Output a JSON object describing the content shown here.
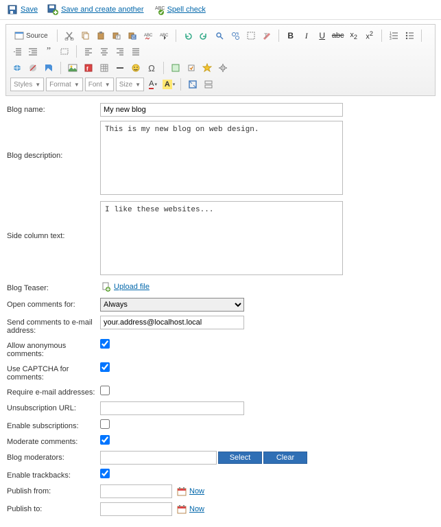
{
  "top": {
    "save": "Save",
    "save_another": "Save and create another",
    "spellcheck": "Spell check"
  },
  "toolbar": {
    "source": "Source",
    "styles": "Styles",
    "format": "Format",
    "font": "Font",
    "size": "Size"
  },
  "fields": {
    "blog_name": {
      "label": "Blog name:",
      "value": "My new blog"
    },
    "blog_desc": {
      "label": "Blog description:",
      "value": "This is my new blog on web design."
    },
    "side_col": {
      "label": "Side column text:",
      "value": "I like these websites..."
    },
    "teaser": {
      "label": "Blog Teaser:",
      "link": "Upload file"
    },
    "open_comments": {
      "label": "Open comments for:",
      "value": "Always"
    },
    "send_email": {
      "label": "Send comments to e-mail address:",
      "value": "your.address@localhost.local"
    },
    "anon": {
      "label": "Allow anonymous comments:"
    },
    "captcha": {
      "label": "Use CAPTCHA for comments:"
    },
    "require_email": {
      "label": "Require e-mail addresses:"
    },
    "unsub": {
      "label": "Unsubscription URL:",
      "value": ""
    },
    "enable_subs": {
      "label": "Enable subscriptions:"
    },
    "moderate": {
      "label": "Moderate comments:"
    },
    "moderators": {
      "label": "Blog moderators:",
      "select": "Select",
      "clear": "Clear"
    },
    "trackbacks": {
      "label": "Enable trackbacks:"
    },
    "pub_from": {
      "label": "Publish from:",
      "now": "Now"
    },
    "pub_to": {
      "label": "Publish to:",
      "now": "Now"
    }
  }
}
